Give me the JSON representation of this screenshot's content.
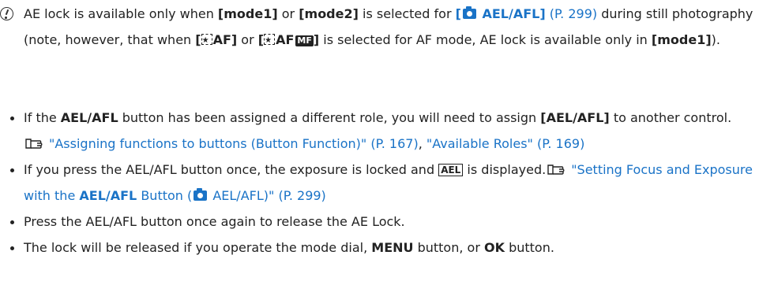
{
  "note": {
    "icon": "caution-icon",
    "t1": "AE lock is available only when ",
    "mode1": "[mode1]",
    "t2": " or ",
    "mode2": "[mode2]",
    "t3": " is selected for ",
    "aefl_open": "[",
    "aefl_label": " AEL/AFL]",
    "aefl_page": " (P. 299)",
    "t4": " during still photography (note, however, that when ",
    "faf1_open": "[",
    "faf1_label": "AF]",
    "t5": " or ",
    "faf2_open": "[",
    "faf2_label": "AF",
    "mf_label": "MF",
    "faf2_close": "]",
    "t6": " is selected for AF mode, AE lock is available only in ",
    "mode1b": "[mode1]",
    "t7": ")."
  },
  "bullets": [
    {
      "b1_t1": "If the ",
      "b1_bold1": "AEL/AFL",
      "b1_t2": " button has been assigned a different role, you will need to assign ",
      "b1_bold2": "[AEL/AFL]",
      "b1_t3": " to another control.",
      "b1_link1": "\"Assigning functions to buttons (Button Function)\" (P. 167)",
      "b1_sep": ", ",
      "b1_link2": "\"Available Roles\" (P. 169)"
    },
    {
      "b2_t1": "If you press the AEL/AFL button once, the exposure is locked and ",
      "b2_ael": "AEL",
      "b2_t2": " is displayed.",
      "b2_link_a": "\"Setting Focus and Exposure with the ",
      "b2_link_bold": "AEL/AFL",
      "b2_link_b": " Button (",
      "b2_link_c": " AEL/AFL)\" (P. 299)"
    },
    {
      "b3_text": "Press the AEL/AFL button once again to release the AE Lock."
    },
    {
      "b4_t1": "The lock will be released if you operate the mode dial, ",
      "b4_bold1": "MENU",
      "b4_t2": " button, or ",
      "b4_bold2": "OK",
      "b4_t3": " button."
    }
  ],
  "colors": {
    "link": "#1a73c7",
    "text": "#222222"
  }
}
